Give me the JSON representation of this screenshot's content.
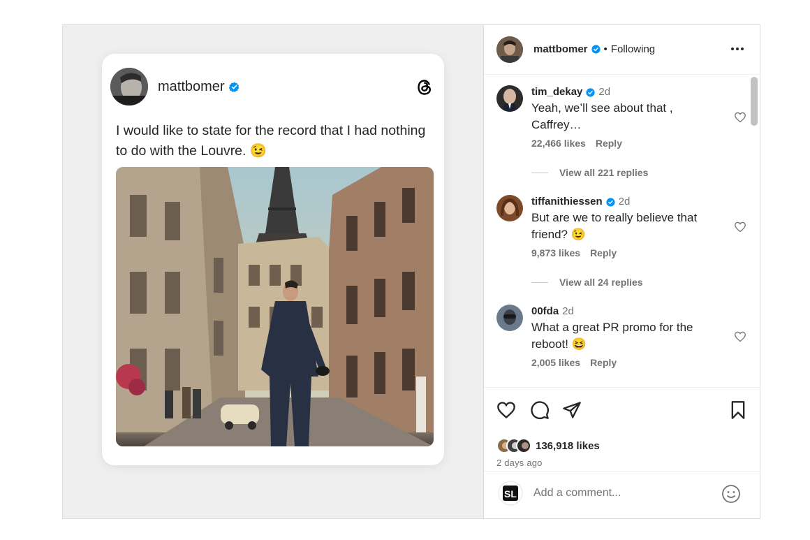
{
  "post_card": {
    "username": "mattbomer",
    "text": "I would like to state for the record that I had nothing to do with the Louvre. 😉"
  },
  "header": {
    "username": "mattbomer",
    "separator": "•",
    "follow_status": "Following"
  },
  "comments": [
    {
      "username": "tim_dekay",
      "verified": true,
      "time": "2d",
      "text": "Yeah, we’ll see about that , Caffrey…",
      "likes": "22,466 likes",
      "reply_label": "Reply",
      "view_replies": "View all 221 replies"
    },
    {
      "username": "tiffanithiessen",
      "verified": true,
      "time": "2d",
      "text": "But are we to really believe that friend? 😉",
      "likes": "9,873 likes",
      "reply_label": "Reply",
      "view_replies": "View all 24 replies"
    },
    {
      "username": "00fda",
      "verified": false,
      "time": "2d",
      "text": "What a great PR promo for the reboot! 😆",
      "likes": "2,005 likes",
      "reply_label": "Reply"
    }
  ],
  "footer": {
    "likes": "136,918 likes",
    "time_ago": "2 days ago",
    "comment_placeholder": "Add a comment...",
    "logo_text": "SL"
  },
  "icons": {
    "verified": "verified-badge-icon",
    "threads": "threads-icon",
    "more": "more-options-icon",
    "like": "heart-icon",
    "comment": "comment-icon",
    "share": "share-icon",
    "save": "bookmark-icon",
    "emoji": "emoji-icon"
  },
  "colors": {
    "verified_blue": "#0095f6",
    "text": "#262626",
    "muted": "#737373",
    "border": "#dbdbdb"
  }
}
